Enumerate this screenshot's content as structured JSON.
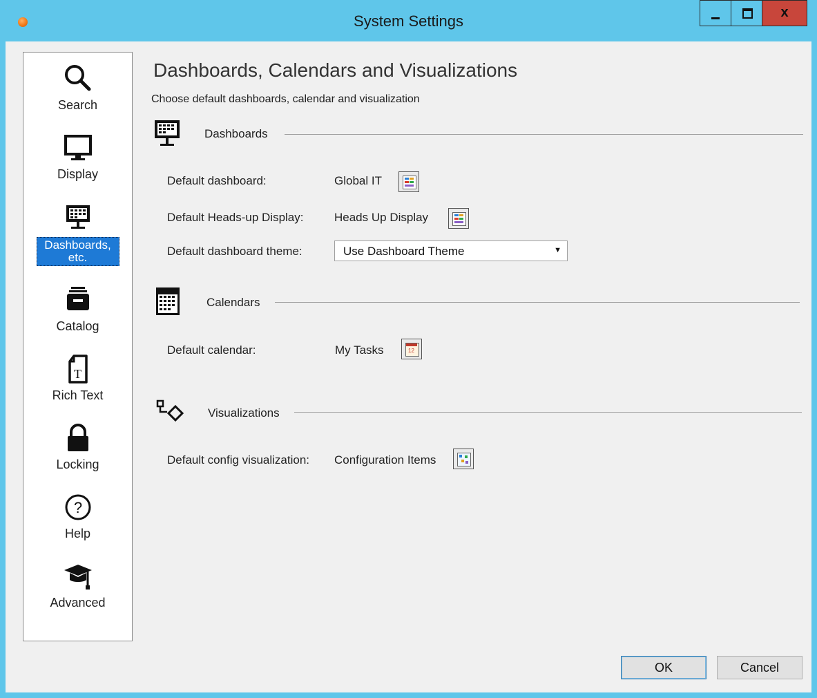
{
  "window": {
    "title": "System Settings",
    "close_label": "x"
  },
  "sidebar": {
    "items": [
      {
        "label": "Search",
        "icon": "search-icon"
      },
      {
        "label": "Display",
        "icon": "monitor-icon"
      },
      {
        "label": "Dashboards, etc.",
        "icon": "dashboard-icon",
        "selected": true
      },
      {
        "label": "Catalog",
        "icon": "catalog-icon"
      },
      {
        "label": "Rich Text",
        "icon": "rich-text-icon"
      },
      {
        "label": "Locking",
        "icon": "lock-icon"
      },
      {
        "label": "Help",
        "icon": "help-icon"
      },
      {
        "label": "Advanced",
        "icon": "graduation-cap-icon"
      }
    ]
  },
  "main": {
    "heading": "Dashboards, Calendars and Visualizations",
    "subheading": "Choose default dashboards, calendar and visualization",
    "dashboards": {
      "section": "Dashboards",
      "default_dashboard_label": "Default dashboard:",
      "default_dashboard_value": "Global IT",
      "heads_up_label": "Default Heads-up Display:",
      "heads_up_value": "Heads Up Display",
      "theme_label": "Default dashboard theme:",
      "theme_value": "Use Dashboard Theme"
    },
    "calendars": {
      "section": "Calendars",
      "default_calendar_label": "Default calendar:",
      "default_calendar_value": "My Tasks"
    },
    "visualizations": {
      "section": "Visualizations",
      "default_viz_label": "Default config visualization:",
      "default_viz_value": "Configuration Items"
    }
  },
  "buttons": {
    "ok": "OK",
    "cancel": "Cancel"
  },
  "colors": {
    "titlebar": "#5fc6ea",
    "selection": "#1e7ad6",
    "close": "#c8463b"
  }
}
